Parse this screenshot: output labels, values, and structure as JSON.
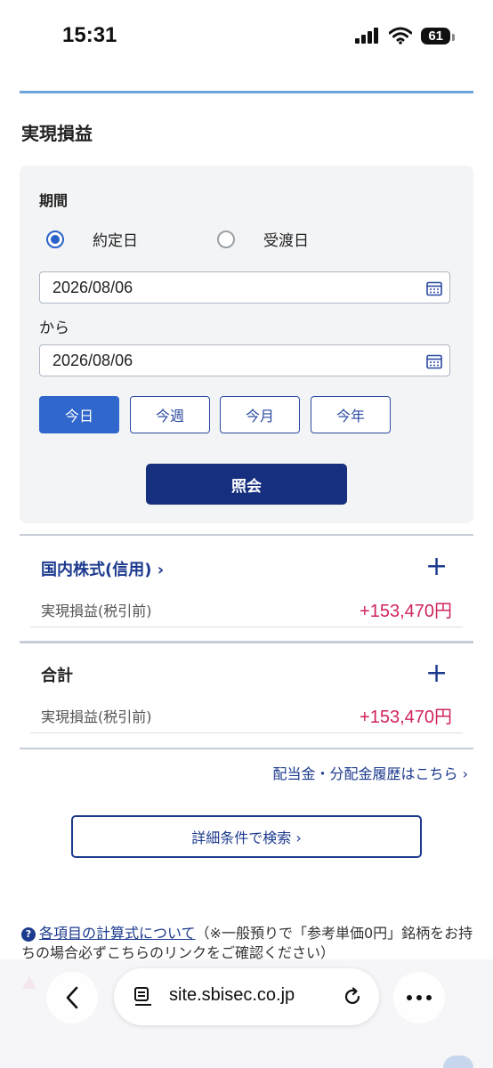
{
  "status": {
    "time": "15:31",
    "battery": "61"
  },
  "section_title": "実現損益",
  "filter": {
    "period_label": "期間",
    "radio_options": [
      {
        "label": "約定日",
        "selected": true
      },
      {
        "label": "受渡日",
        "selected": false
      }
    ],
    "date_from": "2026/08/06",
    "separator": "から",
    "date_to": "2026/08/06",
    "quick_buttons": [
      {
        "label": "今日",
        "active": true
      },
      {
        "label": "今週",
        "active": false
      },
      {
        "label": "今月",
        "active": false
      },
      {
        "label": "今年",
        "active": false
      }
    ],
    "submit_label": "照会"
  },
  "groups": [
    {
      "title": "国内株式(信用)",
      "title_suffix": " ›",
      "row_label": "実現損益(税引前)",
      "row_value": "+153,470円"
    },
    {
      "title": "合計",
      "title_suffix": "",
      "row_label": "実現損益(税引前)",
      "row_value": "+153,470円"
    }
  ],
  "plus_symbol": "+",
  "dividend_link": "配当金・分配金履歴はこちら ›",
  "detail_search_label": "詳細条件で検索 ›",
  "note": {
    "link_text": "各項目の計算式について",
    "text": "（※一般預りで「参考単価0円」銘柄をお持ちの場合必ずこちらのリンクをご確認ください）"
  },
  "browser": {
    "url": "site.sbisec.co.jp"
  },
  "colors": {
    "accent_blue": "#1c3a8e",
    "profit_red": "#d0245a",
    "submit_navy": "#16307f",
    "active_blue": "#2f67cc"
  }
}
